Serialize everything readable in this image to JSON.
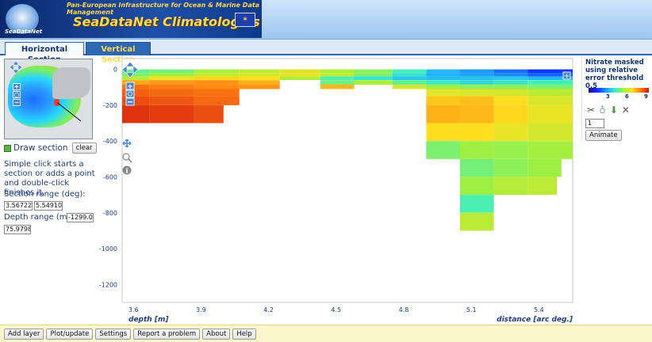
{
  "header": {
    "tagline": "Pan-European Infrastructure for Ocean & Marine Data Management",
    "title": "SeaDataNet Climatologies",
    "logo_text": "SeaDataNet"
  },
  "tabs": [
    {
      "label": "Horizontal Section",
      "active": true
    },
    {
      "label": "Vertical Section",
      "active": false
    }
  ],
  "left_panel": {
    "draw_section_label": "Draw section",
    "clear_label": "clear",
    "help_text": "Simple click starts a section or adds a point and double-click finishes it.",
    "section_range_label": "Section range (deg):",
    "section_range_min": "3.56722",
    "section_range_max": "5.54910",
    "depth_range_label": "Depth range (m):",
    "depth_range_min": "-1299.0",
    "depth_range_max": "75.9798"
  },
  "chart_data": {
    "type": "heatmap",
    "xlabel": "distance [arc deg.]",
    "ylabel": "depth [m]",
    "xlim": [
      3.55,
      5.55
    ],
    "ylim": [
      -1300,
      60
    ],
    "x_ticks": [
      "3.6",
      "3.9",
      "4.2",
      "4.5",
      "4.8",
      "5.1",
      "5.4"
    ],
    "y_ticks": [
      "0",
      "-200",
      "-400",
      "-600",
      "-800",
      "-1000",
      "-1200"
    ],
    "colorscale": {
      "min": 0,
      "max": 9,
      "tick_labels": [
        "3",
        "6",
        "9"
      ]
    },
    "cells": [
      {
        "x0": 3.55,
        "x1": 3.67,
        "y0": -20,
        "y1": 0,
        "v": 4.5
      },
      {
        "x0": 3.67,
        "x1": 3.87,
        "y0": -20,
        "y1": 0,
        "v": 4.7
      },
      {
        "x0": 3.87,
        "x1": 4.07,
        "y0": -20,
        "y1": 0,
        "v": 5.3
      },
      {
        "x0": 4.07,
        "x1": 4.25,
        "y0": -20,
        "y1": 0,
        "v": 5.6
      },
      {
        "x0": 4.25,
        "x1": 4.43,
        "y0": -20,
        "y1": 0,
        "v": 6.0
      },
      {
        "x0": 4.43,
        "x1": 4.58,
        "y0": -20,
        "y1": 0,
        "v": 5.4
      },
      {
        "x0": 4.58,
        "x1": 4.75,
        "y0": -20,
        "y1": 0,
        "v": 5.0
      },
      {
        "x0": 4.75,
        "x1": 4.9,
        "y0": -20,
        "y1": 0,
        "v": 4.1
      },
      {
        "x0": 4.9,
        "x1": 5.05,
        "y0": -20,
        "y1": 0,
        "v": 3.0
      },
      {
        "x0": 5.05,
        "x1": 5.2,
        "y0": -20,
        "y1": 0,
        "v": 2.6
      },
      {
        "x0": 5.2,
        "x1": 5.35,
        "y0": -20,
        "y1": 0,
        "v": 2.1
      },
      {
        "x0": 5.35,
        "x1": 5.55,
        "y0": -20,
        "y1": 0,
        "v": 1.4
      },
      {
        "x0": 3.55,
        "x1": 3.67,
        "y0": -40,
        "y1": -20,
        "v": 4.8
      },
      {
        "x0": 3.67,
        "x1": 3.87,
        "y0": -40,
        "y1": -20,
        "v": 5.2
      },
      {
        "x0": 3.87,
        "x1": 4.07,
        "y0": -40,
        "y1": -20,
        "v": 5.7
      },
      {
        "x0": 4.07,
        "x1": 4.25,
        "y0": -40,
        "y1": -20,
        "v": 5.9
      },
      {
        "x0": 4.25,
        "x1": 4.43,
        "y0": -40,
        "y1": -20,
        "v": 6.2
      },
      {
        "x0": 4.43,
        "x1": 4.58,
        "y0": -40,
        "y1": -20,
        "v": 5.6
      },
      {
        "x0": 4.58,
        "x1": 4.75,
        "y0": -40,
        "y1": -20,
        "v": 4.8
      },
      {
        "x0": 4.75,
        "x1": 4.9,
        "y0": -40,
        "y1": -20,
        "v": 3.8
      },
      {
        "x0": 4.9,
        "x1": 5.05,
        "y0": -40,
        "y1": -20,
        "v": 2.9
      },
      {
        "x0": 5.05,
        "x1": 5.2,
        "y0": -40,
        "y1": -20,
        "v": 2.7
      },
      {
        "x0": 5.2,
        "x1": 5.35,
        "y0": -40,
        "y1": -20,
        "v": 2.4
      },
      {
        "x0": 5.35,
        "x1": 5.55,
        "y0": -40,
        "y1": -20,
        "v": 1.9
      },
      {
        "x0": 3.55,
        "x1": 3.67,
        "y0": -60,
        "y1": -40,
        "v": 5.6
      },
      {
        "x0": 3.67,
        "x1": 3.87,
        "y0": -60,
        "y1": -40,
        "v": 6.3
      },
      {
        "x0": 3.87,
        "x1": 4.07,
        "y0": -60,
        "y1": -40,
        "v": 6.6
      },
      {
        "x0": 4.07,
        "x1": 4.25,
        "y0": -60,
        "y1": -40,
        "v": 6.4
      },
      {
        "x0": 4.25,
        "x1": 4.43,
        "y0": -60,
        "y1": -40,
        "v": 5.4
      },
      {
        "x0": 4.43,
        "x1": 4.58,
        "y0": -60,
        "y1": -40,
        "v": 4.2
      },
      {
        "x0": 4.58,
        "x1": 4.75,
        "y0": -60,
        "y1": -40,
        "v": 3.8
      },
      {
        "x0": 4.75,
        "x1": 4.9,
        "y0": -60,
        "y1": -40,
        "v": 3.3
      },
      {
        "x0": 4.9,
        "x1": 5.05,
        "y0": -60,
        "y1": -40,
        "v": 3.1
      },
      {
        "x0": 5.05,
        "x1": 5.2,
        "y0": -60,
        "y1": -40,
        "v": 3.2
      },
      {
        "x0": 5.2,
        "x1": 5.35,
        "y0": -60,
        "y1": -40,
        "v": 3.3
      },
      {
        "x0": 5.35,
        "x1": 5.55,
        "y0": -60,
        "y1": -40,
        "v": 3.0
      },
      {
        "x0": 3.55,
        "x1": 3.67,
        "y0": -85,
        "y1": -60,
        "v": 7.2
      },
      {
        "x0": 3.67,
        "x1": 3.87,
        "y0": -85,
        "y1": -60,
        "v": 7.4
      },
      {
        "x0": 3.87,
        "x1": 4.07,
        "y0": -85,
        "y1": -60,
        "v": 7.5
      },
      {
        "x0": 4.07,
        "x1": 4.25,
        "y0": -85,
        "y1": -60,
        "v": 7.1
      },
      {
        "x0": 4.43,
        "x1": 4.58,
        "y0": -85,
        "y1": -60,
        "v": 4.6
      },
      {
        "x0": 4.58,
        "x1": 4.75,
        "y0": -85,
        "y1": -60,
        "v": 5.3
      },
      {
        "x0": 4.75,
        "x1": 4.9,
        "y0": -85,
        "y1": -60,
        "v": 4.4
      },
      {
        "x0": 4.9,
        "x1": 5.05,
        "y0": -85,
        "y1": -60,
        "v": 3.9
      },
      {
        "x0": 5.05,
        "x1": 5.2,
        "y0": -85,
        "y1": -60,
        "v": 3.6
      },
      {
        "x0": 5.2,
        "x1": 5.35,
        "y0": -85,
        "y1": -60,
        "v": 3.8
      },
      {
        "x0": 5.35,
        "x1": 5.55,
        "y0": -85,
        "y1": -60,
        "v": 4.1
      },
      {
        "x0": 3.55,
        "x1": 3.67,
        "y0": -110,
        "y1": -85,
        "v": 7.9
      },
      {
        "x0": 3.67,
        "x1": 3.87,
        "y0": -110,
        "y1": -85,
        "v": 7.8
      },
      {
        "x0": 3.87,
        "x1": 4.07,
        "y0": -110,
        "y1": -85,
        "v": 7.6
      },
      {
        "x0": 4.07,
        "x1": 4.25,
        "y0": -110,
        "y1": -85,
        "v": 7.5
      },
      {
        "x0": 4.43,
        "x1": 4.58,
        "y0": -110,
        "y1": -85,
        "v": 7.0
      },
      {
        "x0": 4.75,
        "x1": 4.9,
        "y0": -110,
        "y1": -85,
        "v": 5.9
      },
      {
        "x0": 4.9,
        "x1": 5.05,
        "y0": -110,
        "y1": -85,
        "v": 5.2
      },
      {
        "x0": 5.05,
        "x1": 5.2,
        "y0": -110,
        "y1": -85,
        "v": 5.0
      },
      {
        "x0": 5.2,
        "x1": 5.35,
        "y0": -110,
        "y1": -85,
        "v": 5.0
      },
      {
        "x0": 5.35,
        "x1": 5.55,
        "y0": -110,
        "y1": -85,
        "v": 4.8
      },
      {
        "x0": 3.55,
        "x1": 3.67,
        "y0": -150,
        "y1": -110,
        "v": 8.1
      },
      {
        "x0": 3.67,
        "x1": 3.87,
        "y0": -150,
        "y1": -110,
        "v": 8.0
      },
      {
        "x0": 3.87,
        "x1": 4.07,
        "y0": -150,
        "y1": -110,
        "v": 7.9
      },
      {
        "x0": 4.9,
        "x1": 5.05,
        "y0": -150,
        "y1": -110,
        "v": 6.1
      },
      {
        "x0": 5.05,
        "x1": 5.2,
        "y0": -150,
        "y1": -110,
        "v": 6.0
      },
      {
        "x0": 5.2,
        "x1": 5.35,
        "y0": -150,
        "y1": -110,
        "v": 5.9
      },
      {
        "x0": 5.35,
        "x1": 5.55,
        "y0": -150,
        "y1": -110,
        "v": 5.6
      },
      {
        "x0": 3.55,
        "x1": 3.67,
        "y0": -200,
        "y1": -150,
        "v": 8.3
      },
      {
        "x0": 3.67,
        "x1": 3.87,
        "y0": -200,
        "y1": -150,
        "v": 8.2
      },
      {
        "x0": 3.87,
        "x1": 4.07,
        "y0": -200,
        "y1": -150,
        "v": 8.0
      },
      {
        "x0": 4.9,
        "x1": 5.05,
        "y0": -200,
        "y1": -150,
        "v": 6.8
      },
      {
        "x0": 5.05,
        "x1": 5.2,
        "y0": -200,
        "y1": -150,
        "v": 6.9
      },
      {
        "x0": 5.2,
        "x1": 5.35,
        "y0": -200,
        "y1": -150,
        "v": 6.5
      },
      {
        "x0": 5.35,
        "x1": 5.55,
        "y0": -200,
        "y1": -150,
        "v": 6.0
      },
      {
        "x0": 3.55,
        "x1": 3.67,
        "y0": -300,
        "y1": -200,
        "v": 8.6
      },
      {
        "x0": 3.67,
        "x1": 3.87,
        "y0": -300,
        "y1": -200,
        "v": 8.5
      },
      {
        "x0": 3.87,
        "x1": 4.0,
        "y0": -300,
        "y1": -200,
        "v": 8.3
      },
      {
        "x0": 4.9,
        "x1": 5.05,
        "y0": -300,
        "y1": -200,
        "v": 7.1
      },
      {
        "x0": 5.05,
        "x1": 5.2,
        "y0": -300,
        "y1": -200,
        "v": 7.0
      },
      {
        "x0": 5.2,
        "x1": 5.35,
        "y0": -300,
        "y1": -200,
        "v": 6.6
      },
      {
        "x0": 5.35,
        "x1": 5.55,
        "y0": -300,
        "y1": -200,
        "v": 6.2
      },
      {
        "x0": 4.9,
        "x1": 5.05,
        "y0": -400,
        "y1": -300,
        "v": 6.5
      },
      {
        "x0": 5.05,
        "x1": 5.2,
        "y0": -400,
        "y1": -300,
        "v": 6.5
      },
      {
        "x0": 5.2,
        "x1": 5.35,
        "y0": -400,
        "y1": -300,
        "v": 6.2
      },
      {
        "x0": 5.35,
        "x1": 5.55,
        "y0": -400,
        "y1": -300,
        "v": 5.9
      },
      {
        "x0": 4.9,
        "x1": 5.05,
        "y0": -500,
        "y1": -400,
        "v": 4.8
      },
      {
        "x0": 5.05,
        "x1": 5.2,
        "y0": -500,
        "y1": -400,
        "v": 5.2
      },
      {
        "x0": 5.2,
        "x1": 5.35,
        "y0": -500,
        "y1": -400,
        "v": 5.1
      },
      {
        "x0": 5.35,
        "x1": 5.55,
        "y0": -500,
        "y1": -400,
        "v": 5.3
      },
      {
        "x0": 5.05,
        "x1": 5.2,
        "y0": -600,
        "y1": -500,
        "v": 4.7
      },
      {
        "x0": 5.2,
        "x1": 5.35,
        "y0": -600,
        "y1": -500,
        "v": 5.0
      },
      {
        "x0": 5.35,
        "x1": 5.5,
        "y0": -600,
        "y1": -500,
        "v": 5.2
      },
      {
        "x0": 5.05,
        "x1": 5.2,
        "y0": -700,
        "y1": -600,
        "v": 5.2
      },
      {
        "x0": 5.2,
        "x1": 5.35,
        "y0": -700,
        "y1": -600,
        "v": 5.5
      },
      {
        "x0": 5.35,
        "x1": 5.48,
        "y0": -700,
        "y1": -600,
        "v": 5.6
      },
      {
        "x0": 5.05,
        "x1": 5.2,
        "y0": -800,
        "y1": -700,
        "v": 4.2
      },
      {
        "x0": 5.05,
        "x1": 5.2,
        "y0": -900,
        "y1": -800,
        "v": 5.6
      }
    ]
  },
  "legend": {
    "title": "Nitrate masked using relative error threshold 0.5",
    "frame_value": "1",
    "animate_label": "Animate",
    "tool_icons": [
      "wrench-icon",
      "bulb-icon",
      "download-icon",
      "close-icon"
    ]
  },
  "footer": {
    "buttons": [
      "Add layer",
      "Plot/update",
      "Settings",
      "Report a problem",
      "About",
      "Help"
    ]
  }
}
